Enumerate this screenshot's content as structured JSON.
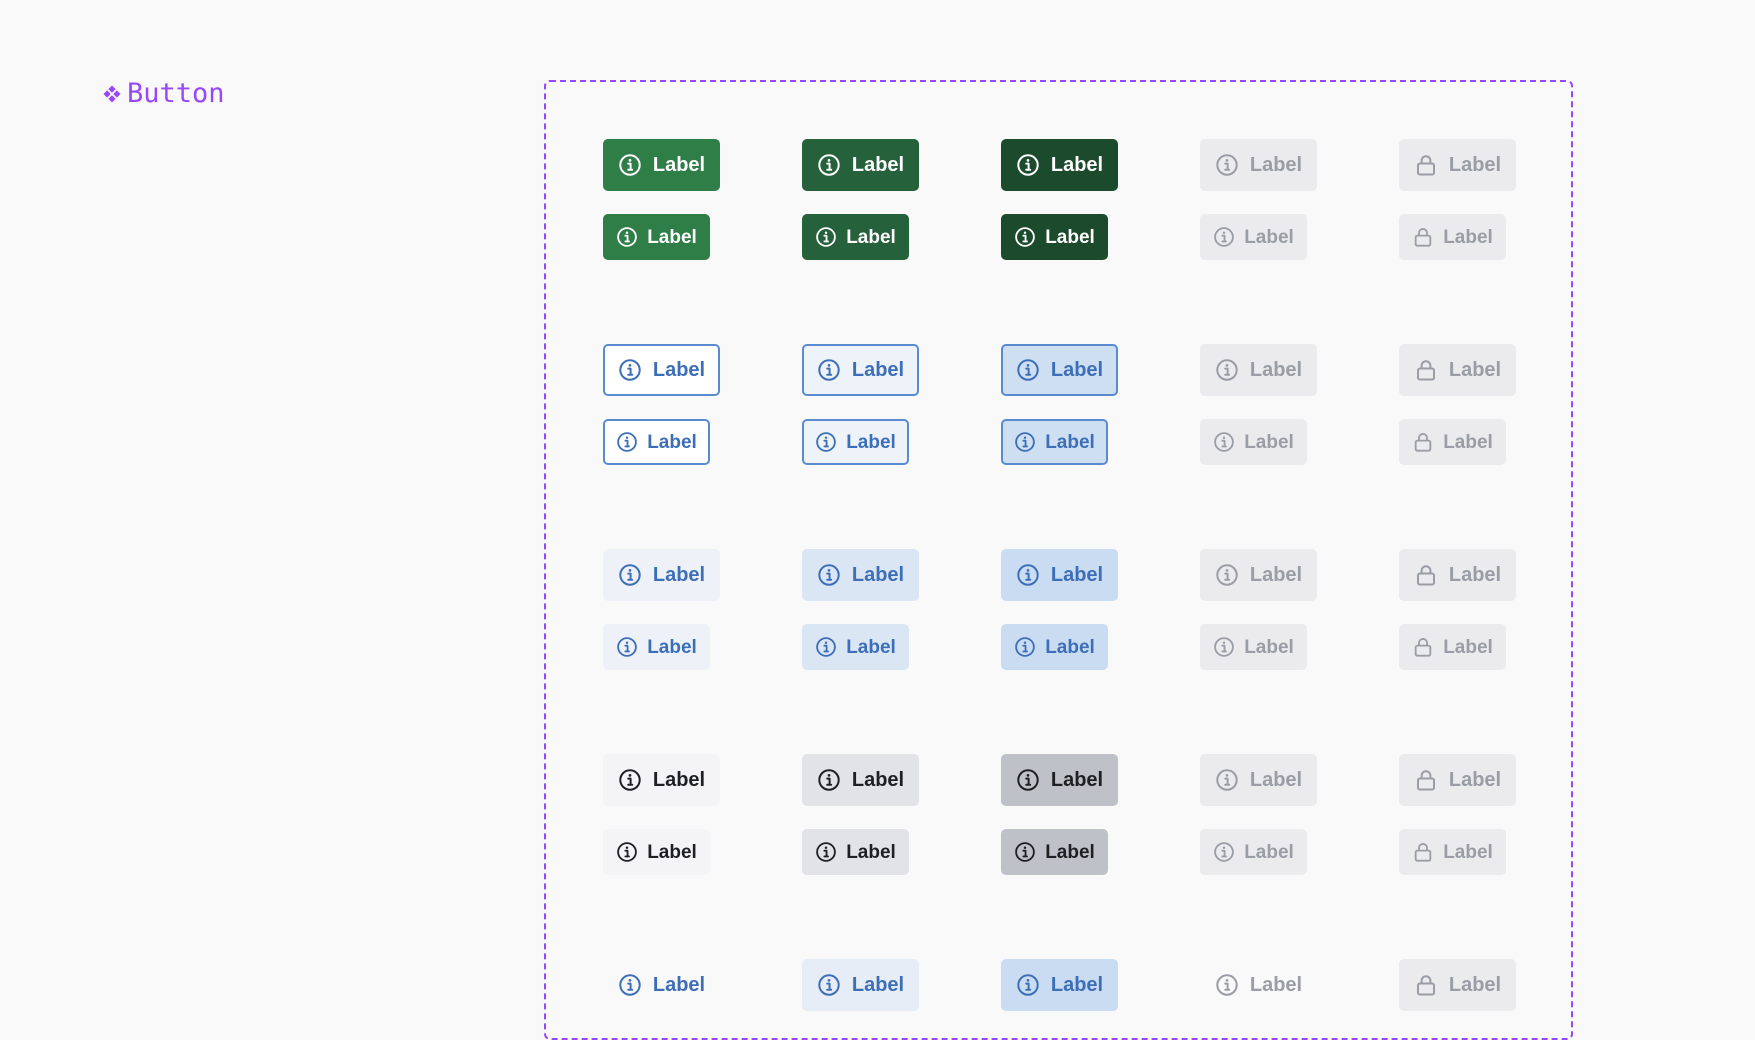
{
  "title": {
    "text": "Button",
    "icon": "component-diamond-icon",
    "color": "#9747ff"
  },
  "frame": {
    "border_color": "#9747ff"
  },
  "columns": [
    "default",
    "hover",
    "pressed",
    "disabled",
    "locked"
  ],
  "rows": [
    {
      "variant": "primary",
      "buttons": [
        {
          "state": "default",
          "label": "Label",
          "icon": "info-icon",
          "bg": "#2f7d47",
          "fg": "#ffffff",
          "border": "#2f7d47"
        },
        {
          "state": "hover",
          "label": "Label",
          "icon": "info-icon",
          "bg": "#25613a",
          "fg": "#ffffff",
          "border": "#25613a"
        },
        {
          "state": "pressed",
          "label": "Label",
          "icon": "info-icon",
          "bg": "#1c4a2c",
          "fg": "#ffffff",
          "border": "#1c4a2c"
        },
        {
          "state": "disabled",
          "label": "Label",
          "icon": "info-icon",
          "bg": "#ebebee",
          "fg": "#9a9da6",
          "border": "#ebebee"
        },
        {
          "state": "locked",
          "label": "Label",
          "icon": "lock-icon",
          "bg": "#ebebee",
          "fg": "#9a9da6",
          "border": "#ebebee"
        }
      ]
    },
    {
      "variant": "secondary",
      "buttons": [
        {
          "state": "default",
          "label": "Label",
          "icon": "info-icon",
          "bg": "#ffffff",
          "fg": "#3d6fb8",
          "border": "#5a8bd1"
        },
        {
          "state": "hover",
          "label": "Label",
          "icon": "info-icon",
          "bg": "#eef3fa",
          "fg": "#3d6fb8",
          "border": "#5a8bd1"
        },
        {
          "state": "pressed",
          "label": "Label",
          "icon": "info-icon",
          "bg": "#cfdff2",
          "fg": "#3d6fb8",
          "border": "#5a8bd1"
        },
        {
          "state": "disabled",
          "label": "Label",
          "icon": "info-icon",
          "bg": "#ebebee",
          "fg": "#9a9da6",
          "border": "#ebebee"
        },
        {
          "state": "locked",
          "label": "Label",
          "icon": "lock-icon",
          "bg": "#ebebee",
          "fg": "#9a9da6",
          "border": "#ebebee"
        }
      ]
    },
    {
      "variant": "tertiary",
      "buttons": [
        {
          "state": "default",
          "label": "Label",
          "icon": "info-icon",
          "bg": "#eef2f8",
          "fg": "#3d6fb8",
          "border": "#eef2f8"
        },
        {
          "state": "hover",
          "label": "Label",
          "icon": "info-icon",
          "bg": "#dbe6f4",
          "fg": "#3d6fb8",
          "border": "#dbe6f4"
        },
        {
          "state": "pressed",
          "label": "Label",
          "icon": "info-icon",
          "bg": "#cadcf1",
          "fg": "#3d6fb8",
          "border": "#cadcf1"
        },
        {
          "state": "disabled",
          "label": "Label",
          "icon": "info-icon",
          "bg": "#ebebee",
          "fg": "#9a9da6",
          "border": "#ebebee"
        },
        {
          "state": "locked",
          "label": "Label",
          "icon": "lock-icon",
          "bg": "#ebebee",
          "fg": "#9a9da6",
          "border": "#ebebee"
        }
      ]
    },
    {
      "variant": "neutral",
      "buttons": [
        {
          "state": "default",
          "label": "Label",
          "icon": "info-icon",
          "bg": "#f4f4f6",
          "fg": "#1f2024",
          "border": "#f4f4f6"
        },
        {
          "state": "hover",
          "label": "Label",
          "icon": "info-icon",
          "bg": "#e2e3e7",
          "fg": "#1f2024",
          "border": "#e2e3e7"
        },
        {
          "state": "pressed",
          "label": "Label",
          "icon": "info-icon",
          "bg": "#bfc1c8",
          "fg": "#1f2024",
          "border": "#bfc1c8"
        },
        {
          "state": "disabled",
          "label": "Label",
          "icon": "info-icon",
          "bg": "#ebebee",
          "fg": "#9a9da6",
          "border": "#ebebee"
        },
        {
          "state": "locked",
          "label": "Label",
          "icon": "lock-icon",
          "bg": "#ebebee",
          "fg": "#9a9da6",
          "border": "#ebebee"
        }
      ]
    },
    {
      "variant": "ghost",
      "buttons": [
        {
          "state": "default",
          "label": "Label",
          "icon": "info-icon",
          "bg": "#f9f9fa",
          "fg": "#3d6fb8",
          "border": "#f9f9fa"
        },
        {
          "state": "hover",
          "label": "Label",
          "icon": "info-icon",
          "bg": "#e6edf7",
          "fg": "#3d6fb8",
          "border": "#e6edf7"
        },
        {
          "state": "pressed",
          "label": "Label",
          "icon": "info-icon",
          "bg": "#cadcf1",
          "fg": "#3d6fb8",
          "border": "#cadcf1"
        },
        {
          "state": "disabled",
          "label": "Label",
          "icon": "info-icon",
          "bg": "#f9f9fa",
          "fg": "#9a9da6",
          "border": "#f9f9fa"
        },
        {
          "state": "locked",
          "label": "Label",
          "icon": "lock-icon",
          "bg": "#ebebee",
          "fg": "#9a9da6",
          "border": "#ebebee"
        }
      ]
    }
  ]
}
